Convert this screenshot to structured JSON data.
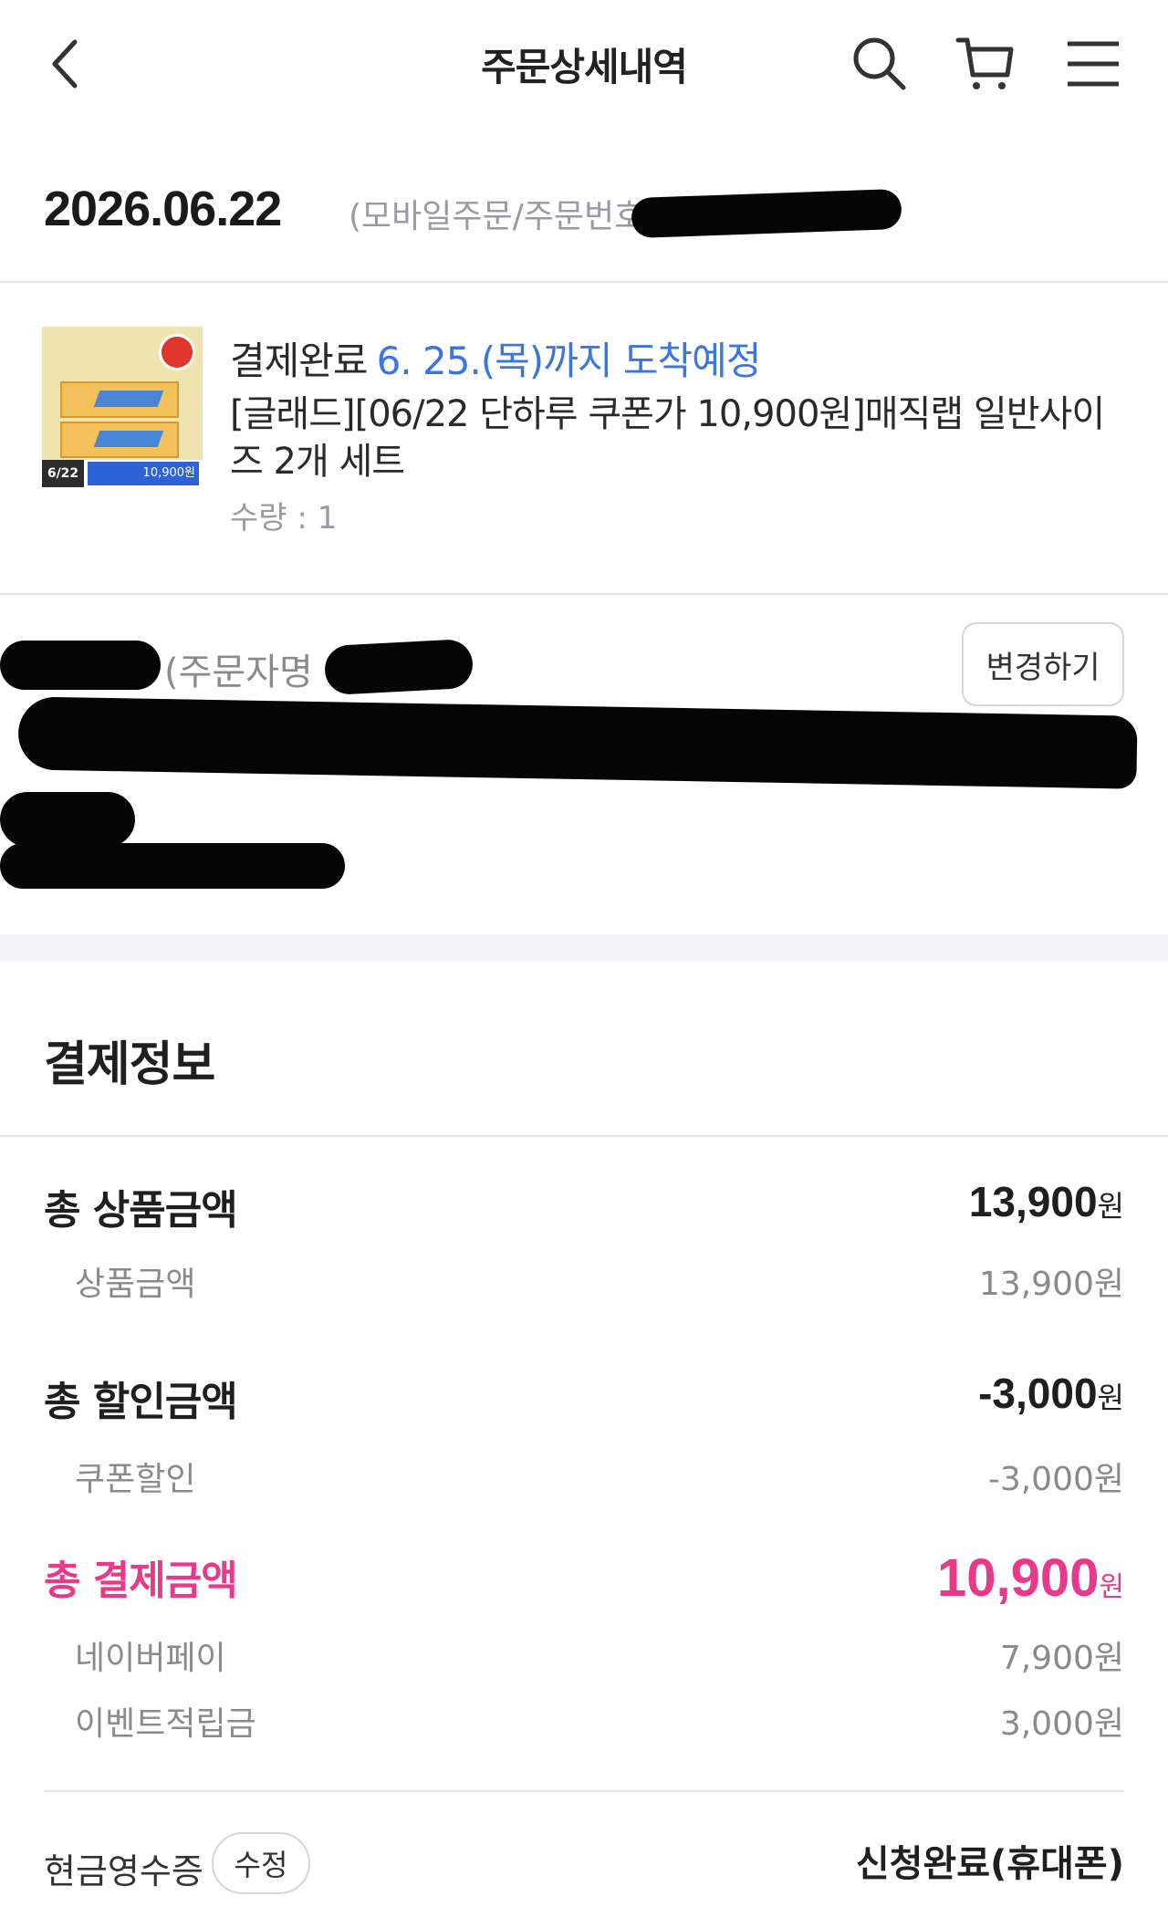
{
  "header": {
    "title": "주문상세내역",
    "back_icon": "chevron-left-icon",
    "search_icon": "search-icon",
    "cart_icon": "cart-icon",
    "menu_icon": "hamburger-menu-icon"
  },
  "order": {
    "date": "2026.06.22",
    "meta": "(모바일주문/주문번호:"
  },
  "product": {
    "thumb_date": "6/22",
    "thumb_price": "10,900원",
    "status": "결제완료",
    "delivery": "6. 25.(목)까지 도착예정",
    "name": "[글래드][06/22 단하루 쿠폰가 10,900원]매직랩 일반사이즈 2개 세트",
    "quantity": "수량 : 1"
  },
  "address": {
    "orderer_label": "(주문자명",
    "change_button": "변경하기"
  },
  "payment": {
    "title": "결제정보",
    "total_product_label": "총 상품금액",
    "total_product_amount": "13,900",
    "product_label": "상품금액",
    "product_amount": "13,900원",
    "total_discount_label": "총 할인금액",
    "total_discount_amount": "-3,000",
    "coupon_label": "쿠폰할인",
    "coupon_amount": "-3,000원",
    "total_pay_label": "총 결제금액",
    "total_pay_amount": "10,900",
    "naverpay_label": "네이버페이",
    "naverpay_amount": "7,900원",
    "event_label": "이벤트적립금",
    "event_amount": "3,000원",
    "won": "원"
  },
  "receipt": {
    "label": "현금영수증",
    "edit_button": "수정",
    "status": "신청완료(휴대폰)"
  },
  "colors": {
    "accent_pink": "#e8398a",
    "delivery_blue": "#3a75e0"
  }
}
